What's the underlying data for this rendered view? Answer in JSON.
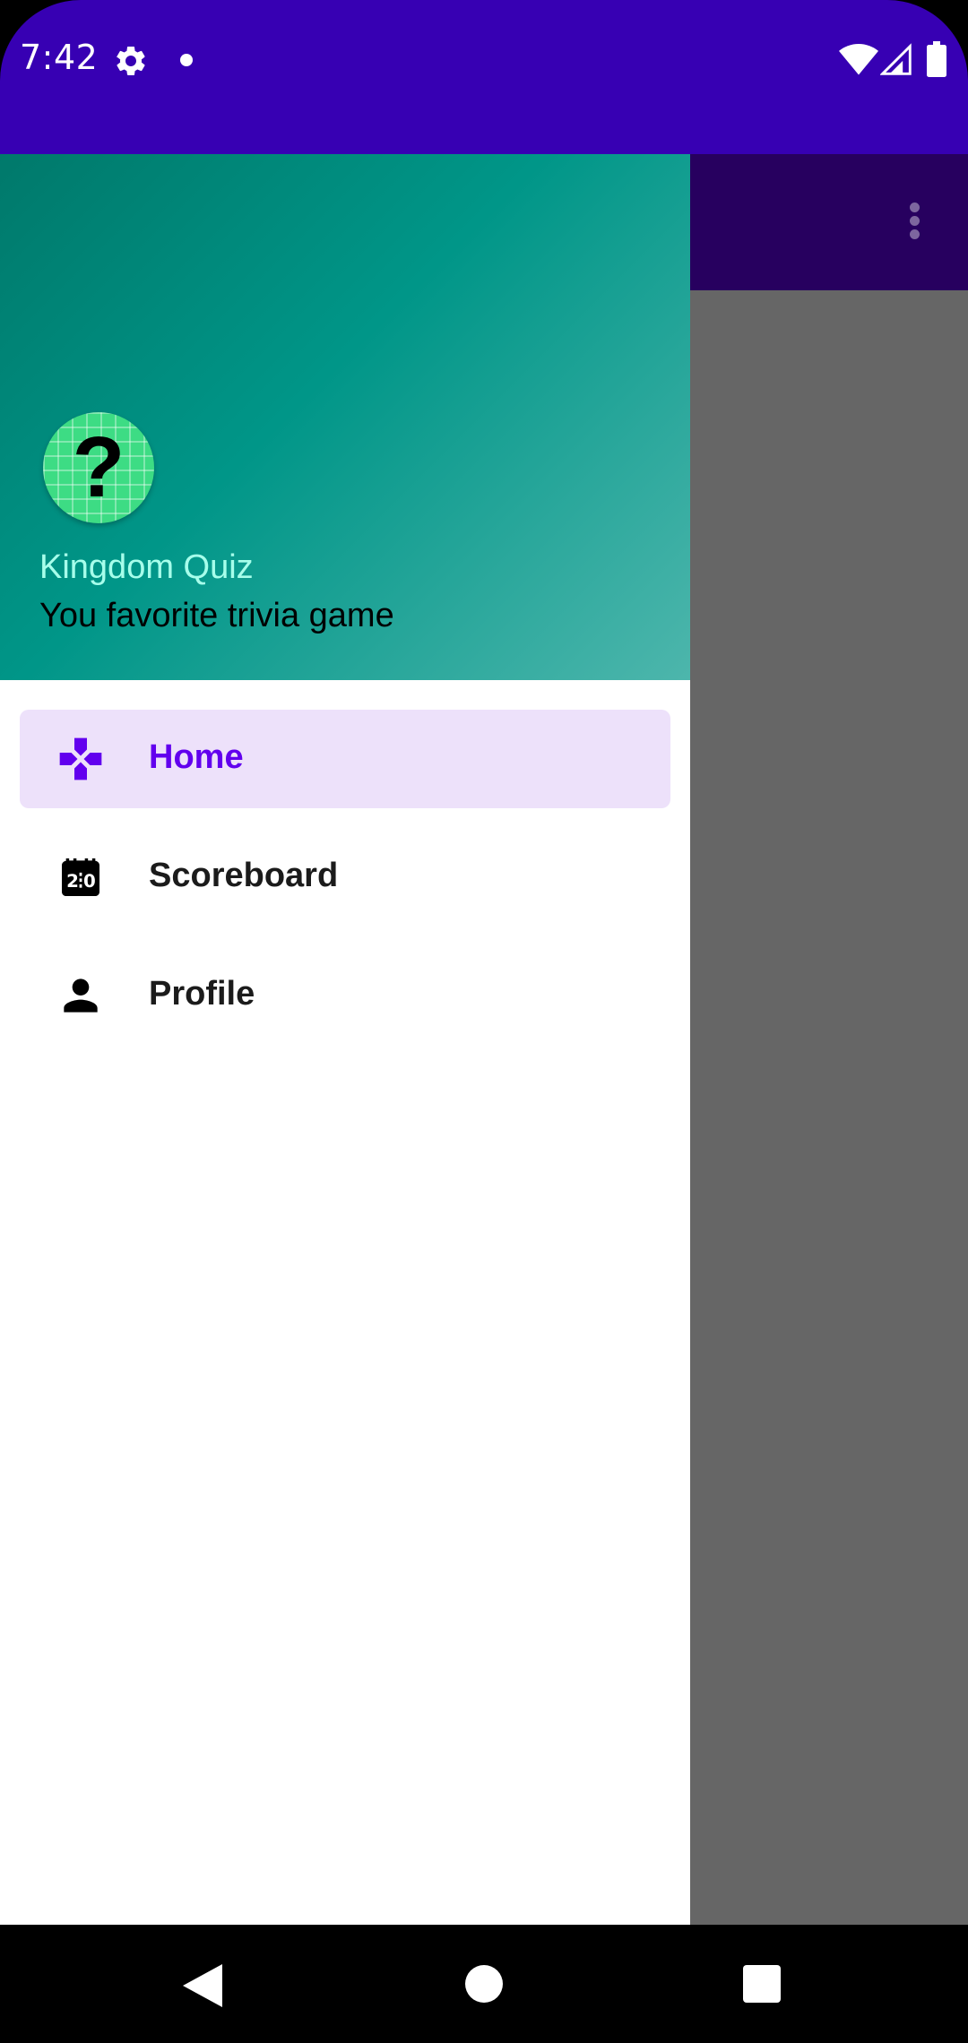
{
  "status_bar": {
    "time": "7:42",
    "icons": [
      "settings-icon",
      "notification-dot-icon",
      "wifi-icon",
      "cell-signal-icon",
      "battery-icon"
    ]
  },
  "app_bar": {
    "menu_icon": "more-vertical-icon",
    "color": "#6200EE"
  },
  "drawer": {
    "header": {
      "avatar_glyph": "?",
      "title": "Kingdom Quiz",
      "subtitle": "You favorite trivia game"
    },
    "items": [
      {
        "label": "Home",
        "icon": "gamepad-icon",
        "active": true
      },
      {
        "label": "Scoreboard",
        "icon": "scoreboard-icon",
        "active": false
      },
      {
        "label": "Profile",
        "icon": "person-icon",
        "active": false
      }
    ]
  },
  "colors": {
    "status_bar": "#3700B3",
    "primary": "#6200EE",
    "active_item_bg": "#EDE1FA",
    "header_gradient_start": "#00796B",
    "header_gradient_end": "#4DB6AC",
    "header_title": "#A7FFEB"
  },
  "system_nav": {
    "buttons": [
      "back-icon",
      "home-icon",
      "recents-icon"
    ]
  }
}
